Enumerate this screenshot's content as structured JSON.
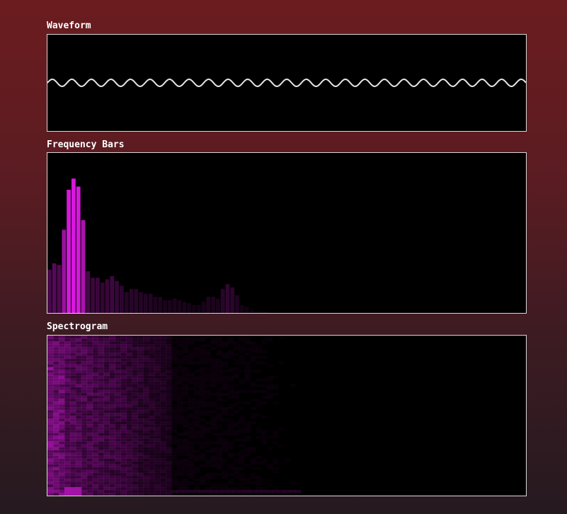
{
  "labels": {
    "waveform": "Waveform",
    "frequency_bars": "Frequency Bars",
    "spectrogram": "Spectrogram"
  },
  "colors": {
    "bar_accent": "#c21ac8",
    "spectro_accent": "#8a1090",
    "wave_line": "#e6e6e6"
  },
  "frequency_bars": {
    "levels": [
      0.27,
      0.31,
      0.3,
      0.52,
      0.77,
      0.84,
      0.79,
      0.58,
      0.26,
      0.22,
      0.22,
      0.19,
      0.21,
      0.23,
      0.2,
      0.17,
      0.13,
      0.15,
      0.15,
      0.13,
      0.12,
      0.12,
      0.1,
      0.1,
      0.08,
      0.08,
      0.09,
      0.08,
      0.07,
      0.06,
      0.05,
      0.05,
      0.07,
      0.1,
      0.1,
      0.09,
      0.15,
      0.18,
      0.16,
      0.11,
      0.05,
      0.04,
      0.02,
      0.01,
      0.01,
      0.01,
      0.0,
      0.0,
      0.0,
      0.0
    ]
  }
}
